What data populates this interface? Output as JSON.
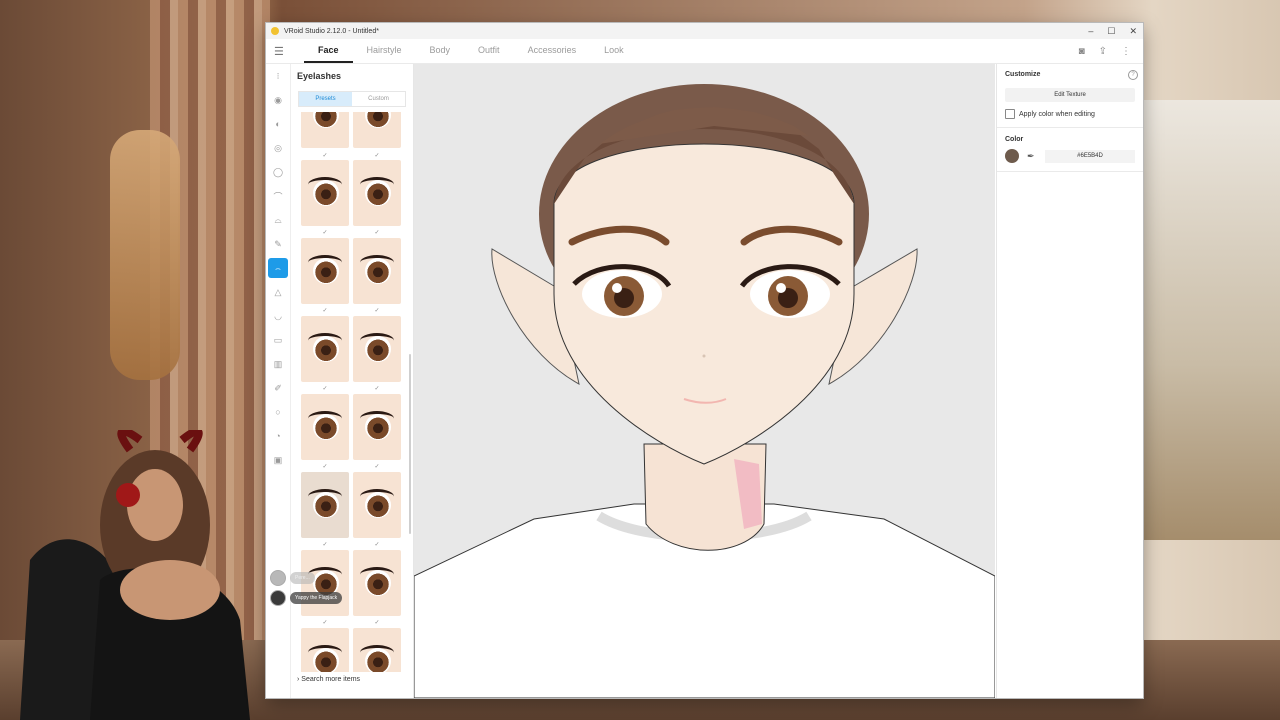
{
  "window": {
    "title": "VRoid Studio 2.12.0 - Untitled*",
    "controls": [
      "–",
      "☐",
      "✕"
    ]
  },
  "menu": {
    "tabs": [
      {
        "label": "Face",
        "active": true
      },
      {
        "label": "Hairstyle",
        "active": false
      },
      {
        "label": "Body",
        "active": false
      },
      {
        "label": "Outfit",
        "active": false
      },
      {
        "label": "Accessories",
        "active": false
      },
      {
        "label": "Look",
        "active": false
      }
    ],
    "right_icons": [
      "camera-icon",
      "share-icon",
      "more-icon"
    ]
  },
  "toolbar": {
    "tools": [
      "face-set-icon",
      "eye-icon",
      "ear-icon",
      "eye-outline-icon",
      "eyeball-icon",
      "brow-icon",
      "eyelid-icon",
      "brush-icon",
      "eyelashes-icon",
      "nose-icon",
      "mouth-icon",
      "mouth-inner-icon",
      "teeth-icon",
      "pen-icon",
      "circle-icon",
      "head-icon",
      "face-paint-icon"
    ],
    "active_index": 8
  },
  "panel": {
    "title": "Eyelashes",
    "segments": [
      {
        "label": "Presets",
        "active": true
      },
      {
        "label": "Custom",
        "active": false
      }
    ],
    "search_more": "Search more items"
  },
  "right_panel": {
    "customize_heading": "Customize",
    "edit_texture": "Edit Texture",
    "apply_color_label": "Apply color when editing",
    "color_heading": "Color",
    "color_hex": "#6E5B4D",
    "swatch_color": "#6e5b4d"
  },
  "chat": {
    "ghost_name": "Pere...",
    "user_name": "Yappy the Flapjack"
  },
  "colors": {
    "accent": "#1e9be8",
    "skin": "#f7e6d6",
    "hair": "#6b4a3a",
    "eye": "#8a5a36"
  }
}
